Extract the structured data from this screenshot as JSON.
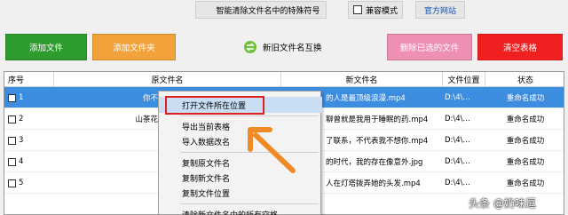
{
  "toolbar": {
    "app_title": "智能清除文件名中的特殊符号",
    "compat_label": "兼容模式",
    "official_label": "官方网站"
  },
  "actions": {
    "add_file": "添加文件",
    "add_folder": "添加文件夹",
    "swap_names": "新旧文件名互换",
    "delete_selected": "删除已选的文件",
    "clear_table": "清空表格"
  },
  "colors": {
    "add_file": "#2e9b2e",
    "add_folder": "#f2a23a",
    "delete_selected": "#ee90b4",
    "clear_table": "#f02020",
    "selected_row": "#3c8de0"
  },
  "table": {
    "headers": [
      "序号",
      "原文件名",
      "新文件名",
      "文件位置",
      "状态"
    ],
    "rows": [
      {
        "no": "1",
        "orig": "你不是真",
        "new": "的人是最顶级浪漫.mp4",
        "loc": "D:\\4\\...",
        "status": "重命名成功"
      },
      {
        "no": "2",
        "orig": "山茶花谈不",
        "new": "聊曾就是我用于睡眠的药.mp4",
        "loc": "D:\\4\\...",
        "status": "重命名成功"
      },
      {
        "no": "3",
        "orig": "岁月",
        "new": "了联系，不代表我不想你.mp4",
        "loc": "D:\\4\\...",
        "status": "重命名成功"
      },
      {
        "no": "4",
        "orig": "乌鸦",
        "new": "的时代，我的存在像意外.jpg",
        "loc": "D:\\4\\...",
        "status": "重命名成功"
      },
      {
        "no": "5",
        "orig": "无人",
        "new": "人在灯塔拨弄她的头发.mp4",
        "loc": "D:\\4\\...",
        "status": "重命名成功"
      }
    ]
  },
  "context_menu": {
    "open_location": "打开文件所在位置",
    "export_table": "导出当前表格",
    "import_rename": "导入数据改名",
    "copy_orig": "复制原文件名",
    "copy_new": "复制新文件名",
    "copy_loc": "复制文件位置",
    "clear_special": "清除新文件名中的所有空格"
  },
  "watermark": "头条 @奶味逗"
}
